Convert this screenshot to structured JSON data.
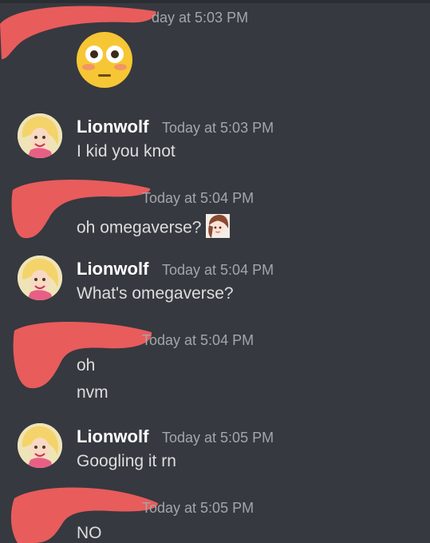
{
  "messages": [
    {
      "author": "",
      "timestamp": "day at 5:03 PM",
      "lines": [],
      "emoji": "flushed-face"
    },
    {
      "author": "Lionwolf",
      "timestamp": "Today at 5:03 PM",
      "lines": [
        "I kid you knot"
      ]
    },
    {
      "author": "",
      "timestamp": "Today at 5:04 PM",
      "lines": [
        "oh omegaverse?"
      ],
      "inline_emoji": "anime-girl-emoji"
    },
    {
      "author": "Lionwolf",
      "timestamp": "Today at 5:04 PM",
      "lines": [
        "What's omegaverse?"
      ]
    },
    {
      "author": "",
      "timestamp": "Today at 5:04 PM",
      "lines": [
        "oh",
        "nvm"
      ]
    },
    {
      "author": "Lionwolf",
      "timestamp": "Today at 5:05 PM",
      "lines": [
        "Googling it rn"
      ]
    },
    {
      "author": "",
      "timestamp": "Today at 5:05 PM",
      "lines": [
        "NO"
      ]
    }
  ],
  "colors": {
    "background": "#36393f",
    "author": "#ffffff",
    "timestamp": "#a3a6aa",
    "message_text": "#dcddde",
    "redaction": "#e85c5c"
  }
}
